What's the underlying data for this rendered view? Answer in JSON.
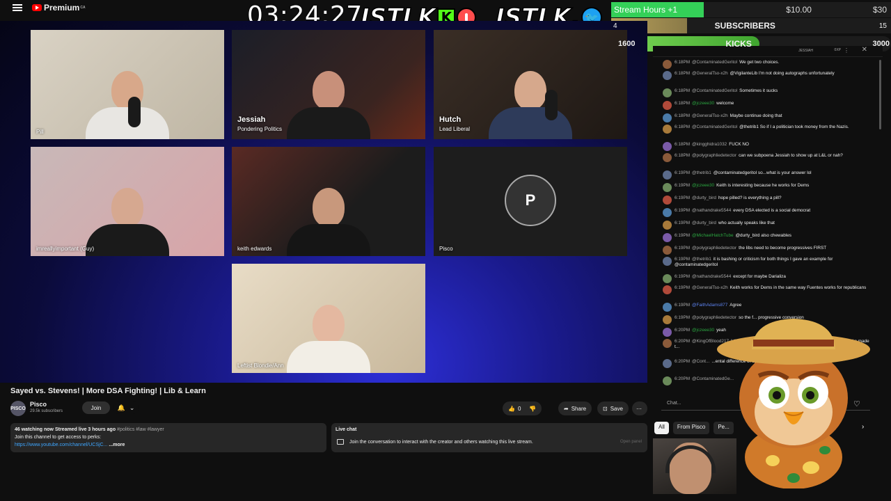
{
  "topbar": {
    "brand": "Premium",
    "brand_sup": "CA"
  },
  "overlay": {
    "timer": "03:24:27",
    "brand_text_1": "JSTLK",
    "brand_text_2": "JSTLK.",
    "kick_badge": "K"
  },
  "goals": {
    "stream_hours": {
      "label": "Stream Hours +1",
      "amount": "$10.00",
      "right": "$30",
      "progress": 0.33
    },
    "subscribers": {
      "left": "4",
      "label": "SUBSCRIBERS",
      "right": "15",
      "progress": 0.27
    },
    "kicks": {
      "left": "1600",
      "label": "KICKS",
      "right": "3000",
      "progress": 0.53
    }
  },
  "tiles": [
    {
      "name": "",
      "sub": "",
      "label": "Pill"
    },
    {
      "name": "Jessiah",
      "sub": "Pondering Politics",
      "label": ""
    },
    {
      "name": "Hutch",
      "sub": "Lead Liberal",
      "label": ""
    },
    {
      "name": "",
      "sub": "",
      "label": "imreallyimportant (Guy)"
    },
    {
      "name": "",
      "sub": "",
      "label": "keith edwards"
    },
    {
      "name": "",
      "sub": "",
      "label": "Pisco",
      "initial": "P"
    },
    {
      "name": "",
      "sub": "",
      "label": "Leftist Blondie/Ann"
    }
  ],
  "video": {
    "title": "Sayed vs. Stevens! | More DSA Fighting! | Lib & Learn",
    "channel": "Pisco",
    "subscribers": "29.5k subscribers",
    "avatar_text": "PISCO",
    "join": "Join",
    "likes": "0",
    "share": "Share",
    "save": "Save"
  },
  "description": {
    "meta": "46 watching now  Streamed live 3 hours ago",
    "tags": "#politics #law #lawyer",
    "line2": "Join this channel to get access to perks:",
    "link": "https://www.youtube.com/channel/UCSjC...",
    "more": "...more"
  },
  "livechat": {
    "title": "Live chat",
    "message": "Join the conversation to interact with the creator and others watching this live stream.",
    "open_panel": "Open panel"
  },
  "chat": {
    "header_xp": "0XP",
    "header_name": "JESSIAH",
    "messages": [
      {
        "time": "6:18PM",
        "user": "@ContaminatedGeritol",
        "text": "We get two choices."
      },
      {
        "time": "6:18PM",
        "user": "@GeneralTso-x2h",
        "text": "@VigilanteLib I'm not doing autographs unfortunately"
      },
      {
        "time": "6:18PM",
        "user": "@ContaminatedGeritol",
        "text": "Sometimes it sucks"
      },
      {
        "time": "6:18PM",
        "user": "@jczeee30",
        "text": "welcome",
        "color": "green"
      },
      {
        "time": "6:18PM",
        "user": "@GeneralTso-x2h",
        "text": "Maybe continue doing that"
      },
      {
        "time": "6:18PM",
        "user": "@ContaminatedGeritol",
        "text": "@thetrib1 So if I a politician took money from the Nazis."
      },
      {
        "time": "6:18PM",
        "user": "@kingghidra1032",
        "text": "FUCK NO"
      },
      {
        "time": "6:18PM",
        "user": "@polygraphliedetector",
        "text": "can we subpoena Jessiah to show up at L&L or nah?"
      },
      {
        "time": "6:19PM",
        "user": "@thetrib1",
        "text": "@contaminatedgeritol so...what is your answer lol"
      },
      {
        "time": "6:19PM",
        "user": "@jczeee30",
        "text": "Keith is interesting because he works for Dems",
        "color": "green"
      },
      {
        "time": "6:19PM",
        "user": "@durty_bird",
        "text": "hope pilled? is everything a pill?"
      },
      {
        "time": "6:19PM",
        "user": "@nathandrake5544",
        "text": "every DSA elected is a social democrat"
      },
      {
        "time": "6:19PM",
        "user": "@durty_bird",
        "text": "who actually speaks like that"
      },
      {
        "time": "6:19PM",
        "user": "@MichaelHatchTube",
        "text": "@durty_bird also chewables",
        "color": "green"
      },
      {
        "time": "6:19PM",
        "user": "@polygraphliedetector",
        "text": "the libs need to become progressives FIRST"
      },
      {
        "time": "6:19PM",
        "user": "@thetrib1",
        "text": "it is bashing or criticism for both things I gave an example for @contaminatedgeritol"
      },
      {
        "time": "6:19PM",
        "user": "@nathandrake5544",
        "text": "except for maybe Darializa"
      },
      {
        "time": "6:19PM",
        "user": "@GeneralTso-x2h",
        "text": "Keith works for Dems in the same way Fuentes works for republicans"
      },
      {
        "time": "6:19PM",
        "user": "@FaithAdams877",
        "text": "Agree",
        "color": "blue"
      },
      {
        "time": "6:19PM",
        "user": "@polygraphliedetector",
        "text": "so the f... progressive conversion"
      },
      {
        "time": "6:20PM",
        "user": "@jczeee30",
        "text": "yeah",
        "color": "green"
      },
      {
        "time": "6:20PM",
        "user": "@KingOfBlood217",
        "text": "I th... only understanding of the DSA on t... of how the org works made t..."
      },
      {
        "time": "6:20PM",
        "user": "@Cont...",
        "text": "...ental difference of opin..."
      },
      {
        "time": "6:20PM",
        "user": "@ContaminatedGe...",
        "text": ""
      }
    ],
    "input_placeholder": "Chat...",
    "tabs": [
      "All",
      "From Pisco",
      "Pe..."
    ]
  },
  "colors": {
    "accent_red": "#ff0000",
    "kick_green": "#53fc18",
    "goal_green": "#34d058",
    "link_blue": "#3ea6ff"
  }
}
